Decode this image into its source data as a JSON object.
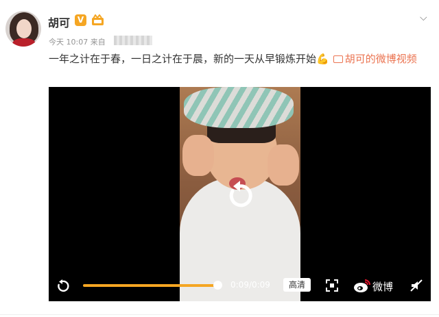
{
  "post": {
    "author": "胡可",
    "verified_badge": "V",
    "time": "今天 10:07",
    "source_prefix": "来自",
    "text": "一年之计在于春，一日之计在于晨，新的一天从早锻炼开始",
    "emoji": "💪",
    "video_link": "胡可的微博视频"
  },
  "player": {
    "time_display": "0:09/0:09",
    "quality_label": "高清",
    "brand_label": "微博",
    "progress_fraction": 1.0
  },
  "colors": {
    "accent": "#f5a623",
    "link": "#eb7350",
    "meta": "#939393"
  },
  "icons": [
    "chevron-down-icon",
    "replay-icon",
    "fullscreen-icon",
    "weibo-logo-icon",
    "mute-icon",
    "video-link-icon"
  ]
}
